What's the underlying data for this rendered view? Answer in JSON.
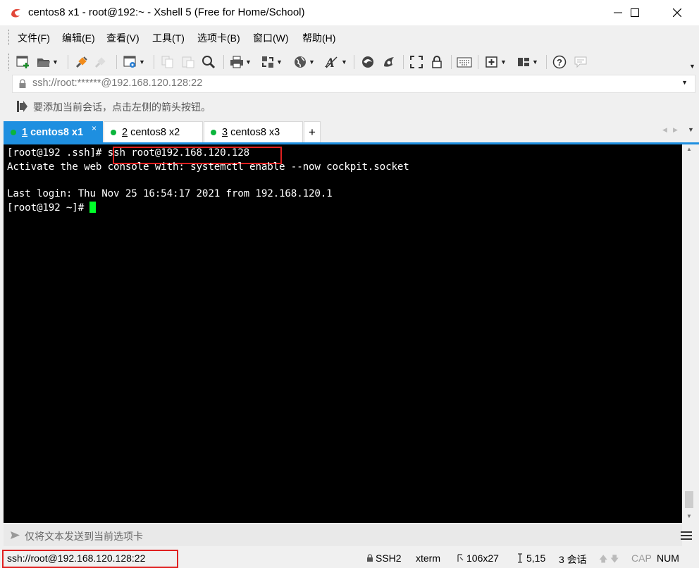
{
  "window": {
    "title": "centos8 x1 - root@192:~ - Xshell 5 (Free for Home/School)"
  },
  "menu": [
    "文件(F)",
    "编辑(E)",
    "查看(V)",
    "工具(T)",
    "选项卡(B)",
    "窗口(W)",
    "帮助(H)"
  ],
  "address": {
    "value": "ssh://root:******@192.168.120.128:22"
  },
  "hint": {
    "text": "要添加当前会话，点击左侧的箭头按钮。"
  },
  "tabs": [
    {
      "num": "1",
      "name": " centos8 x1"
    },
    {
      "num": "2",
      "name": " centos8 x2"
    },
    {
      "num": "3",
      "name": " centos8 x3"
    }
  ],
  "terminal": {
    "line1_prompt": "[root@192 .ssh]# ",
    "line1_cmd": "ssh root@192.168.120.128",
    "line2": "Activate the web console with: systemctl enable --now cockpit.socket",
    "line3": "Last login: Thu Nov 25 16:54:17 2021 from 192.168.120.1",
    "line4_prompt": "[root@192 ~]# "
  },
  "sendbar": {
    "placeholder": "仅将文本发送到当前选项卡"
  },
  "status": {
    "connection": "ssh://root@192.168.120.128:22",
    "protocol": "SSH2",
    "terminal_type": "xterm",
    "size": "106x27",
    "cursor_pos": "5,15",
    "sessions": "3 会话",
    "cap": "CAP",
    "num": "NUM"
  },
  "colors": {
    "accent": "#1e8fe0",
    "highlight": "#e02020",
    "cursor": "#00ff2a",
    "online": "#0bb53c"
  }
}
